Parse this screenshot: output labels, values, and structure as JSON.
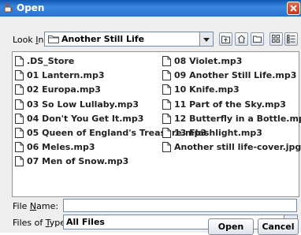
{
  "window": {
    "title": "Open"
  },
  "look_in": {
    "label_pre": "Look ",
    "label_mnemonic": "I",
    "label_post": "n:",
    "value": "Another Still Life"
  },
  "toolbar": {
    "buttons": [
      "up-one-level-icon",
      "home-icon",
      "new-folder-icon",
      "list-view-icon",
      "details-view-icon"
    ]
  },
  "files": {
    "left": [
      ".DS_Store",
      "01 Lantern.mp3",
      "02 Europa.mp3",
      "03 So Low Lullaby.mp3",
      "04 Don't You Get It.mp3",
      "05 Queen of England's Treasure.mp3",
      "06 Meles.mp3",
      "07 Men of Snow.mp3"
    ],
    "right": [
      "08 Violet.mp3",
      "09 Another Still Life.mp3",
      "10 Knife.mp3",
      "11 Part of the Sky.mp3",
      "12 Butterfly in a Bottle.mp3",
      "13 Flashlight.mp3",
      "Another still life-cover.jpg"
    ]
  },
  "file_name": {
    "label_pre": "File ",
    "label_mnemonic": "N",
    "label_post": "ame:",
    "value": ""
  },
  "file_type": {
    "label_pre": "Files of ",
    "label_mnemonic": "T",
    "label_post": "ype:",
    "value": "All Files"
  },
  "buttons": {
    "open": "Open",
    "cancel": "Cancel"
  },
  "colors": {
    "titlebar": "#2b72cf",
    "close": "#c8361a",
    "background": "#eeeeee"
  }
}
